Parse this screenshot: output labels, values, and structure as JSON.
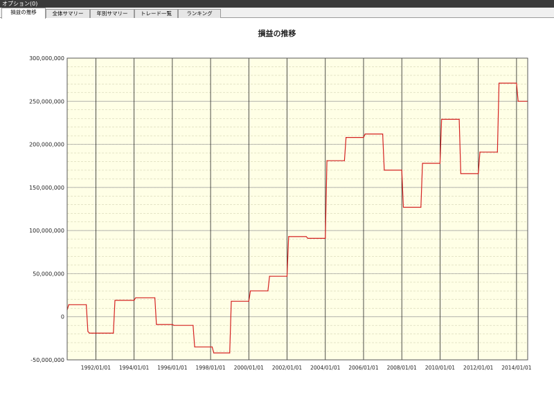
{
  "window": {
    "title": "オプション(0)"
  },
  "tabs": [
    {
      "label": "損益の推移",
      "active": true
    },
    {
      "label": "全体サマリー",
      "active": false
    },
    {
      "label": "年別サマリー",
      "active": false
    },
    {
      "label": "トレード一覧",
      "active": false
    },
    {
      "label": "ランキング",
      "active": false
    }
  ],
  "chart_data": {
    "type": "line",
    "title": "損益の推移",
    "xlabel": "",
    "ylabel": "",
    "xlim": [
      "1990/07/01",
      "2014/08/01"
    ],
    "ylim": [
      -50000000,
      300000000
    ],
    "y_tick_labels": [
      "300,000,000",
      "250,000,000",
      "200,000,000",
      "150,000,000",
      "100,000,000",
      "50,000,000",
      "0",
      "-50,000,000"
    ],
    "x_tick_labels": [
      "1992/01/01",
      "1994/01/01",
      "1996/01/01",
      "1998/01/01",
      "2000/01/01",
      "2002/01/01",
      "2004/01/01",
      "2006/01/01",
      "2008/01/01",
      "2010/01/01",
      "2012/01/01",
      "2014/01/01"
    ],
    "grid": true,
    "legend": "none",
    "series": [
      {
        "color": "#d42020",
        "step": true,
        "points": [
          [
            "1990/07/01",
            8000000
          ],
          [
            "1990/08/01",
            14000000
          ],
          [
            "1991/07/01",
            14000000
          ],
          [
            "1991/08/01",
            -17000000
          ],
          [
            "1991/09/01",
            -19000000
          ],
          [
            "1992/12/01",
            -19000000
          ],
          [
            "1993/01/01",
            19000000
          ],
          [
            "1994/01/01",
            19000000
          ],
          [
            "1994/02/01",
            22000000
          ],
          [
            "1995/02/01",
            22000000
          ],
          [
            "1995/03/01",
            -9000000
          ],
          [
            "1996/01/01",
            -9000000
          ],
          [
            "1996/02/01",
            -10000000
          ],
          [
            "1997/02/01",
            -10000000
          ],
          [
            "1997/03/01",
            -35000000
          ],
          [
            "1998/02/01",
            -35000000
          ],
          [
            "1998/03/01",
            -42000000
          ],
          [
            "1999/01/01",
            -42000000
          ],
          [
            "1999/02/01",
            18000000
          ],
          [
            "2000/01/01",
            18000000
          ],
          [
            "2000/02/01",
            30000000
          ],
          [
            "2001/01/01",
            30000000
          ],
          [
            "2001/02/01",
            47000000
          ],
          [
            "2002/01/01",
            47000000
          ],
          [
            "2002/02/01",
            93000000
          ],
          [
            "2003/01/01",
            93000000
          ],
          [
            "2003/02/01",
            91000000
          ],
          [
            "2004/01/01",
            91000000
          ],
          [
            "2004/02/01",
            181000000
          ],
          [
            "2005/01/01",
            181000000
          ],
          [
            "2005/02/01",
            208000000
          ],
          [
            "2006/01/01",
            208000000
          ],
          [
            "2006/02/01",
            212000000
          ],
          [
            "2007/01/01",
            212000000
          ],
          [
            "2007/02/01",
            170000000
          ],
          [
            "2008/01/01",
            170000000
          ],
          [
            "2008/02/01",
            127000000
          ],
          [
            "2009/01/01",
            127000000
          ],
          [
            "2009/02/01",
            178000000
          ],
          [
            "2010/01/01",
            178000000
          ],
          [
            "2010/02/01",
            229000000
          ],
          [
            "2011/01/01",
            229000000
          ],
          [
            "2011/02/01",
            166000000
          ],
          [
            "2012/01/01",
            166000000
          ],
          [
            "2012/02/01",
            191000000
          ],
          [
            "2013/01/01",
            191000000
          ],
          [
            "2013/02/01",
            271000000
          ],
          [
            "2014/01/01",
            271000000
          ],
          [
            "2014/02/01",
            250000000
          ],
          [
            "2014/08/01",
            250000000
          ]
        ]
      }
    ]
  }
}
